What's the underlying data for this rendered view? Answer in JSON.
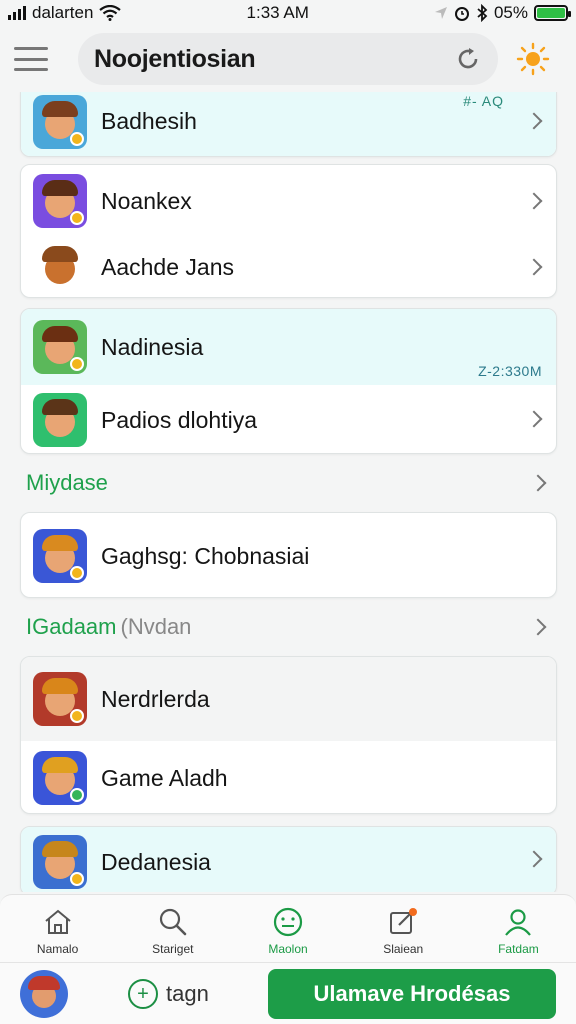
{
  "status_bar": {
    "carrier": "dalarten",
    "time": "1:33 AM",
    "battery": "05%"
  },
  "header": {
    "title": "Noojentiosian"
  },
  "cards": [
    {
      "rows": [
        {
          "label": "Badhesih",
          "meta": "#- AQ",
          "colors": {
            "bg": "#4aa7d9",
            "hat": "#7b3f1e"
          }
        }
      ]
    },
    {
      "rows": [
        {
          "label": "Noankex",
          "colors": {
            "bg": "#7a4de0",
            "hat": "#5a2d16"
          }
        },
        {
          "label": "Aachde Jans",
          "colors": {
            "bg": "#ffffff",
            "hat": "#8a4a1c"
          }
        }
      ]
    },
    {
      "rows": [
        {
          "label": "Nadinesia",
          "meta": "Z-2:330M",
          "colors": {
            "bg": "#5bb85a",
            "hat": "#6b2f12"
          }
        },
        {
          "label": "Padios dlohtiya",
          "colors": {
            "bg": "#2fbf6e",
            "hat": "#5b3418"
          }
        }
      ]
    }
  ],
  "section1": {
    "label": "Miydase"
  },
  "card4": {
    "label": "Gaghsg: Chobnasiai",
    "colors": {
      "bg": "#3a57d6",
      "hat": "#d98a1f"
    }
  },
  "section2": {
    "label": "IGadaam",
    "muted": "(Nvdan"
  },
  "card5": {
    "rows": [
      {
        "label": "Nerdrlerda",
        "colors": {
          "bg": "#b23a2a",
          "hat": "#d9861a"
        }
      },
      {
        "label": "Game Aladh",
        "colors": {
          "bg": "#3a55d8",
          "hat": "#e0a020"
        }
      }
    ]
  },
  "card6": {
    "label": "Dedanesia",
    "colors": {
      "bg": "#3b6fd0",
      "hat": "#c6861c"
    }
  },
  "nav": {
    "tabs": [
      {
        "label": "Namalo"
      },
      {
        "label": "Stariget"
      },
      {
        "label": "Maolon"
      },
      {
        "label": "Slaiean"
      },
      {
        "label": "Fatdam"
      }
    ]
  },
  "bottom": {
    "tag": "tagn",
    "cta": "Ulamave Hrodésas"
  },
  "theme": {
    "accent": "#1d9d48",
    "tint": "#e7fafa"
  }
}
